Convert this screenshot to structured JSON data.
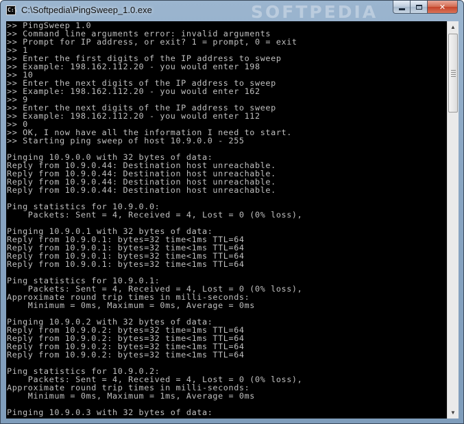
{
  "window": {
    "title": "C:\\Softpedia\\PingSweep_1.0.exe",
    "watermark": "SOFTPEDIA",
    "app_icon_glyph": "C:\\",
    "icons": {
      "app": "console-app-icon",
      "minimize": "minimize-icon",
      "maximize": "maximize-icon",
      "close": "close-icon"
    },
    "close_glyph": "✕"
  },
  "console": {
    "colors": {
      "background": "#000000",
      "text": "#c0c0c0"
    },
    "lines": [
      ">> PingSweep 1.0",
      ">> Command line arguments error: invalid arguments",
      ">> Prompt for IP address, or exit? 1 = prompt, 0 = exit",
      ">> 1",
      ">> Enter the first digits of the IP address to sweep",
      ">> Example: 198.162.112.20 - you would enter 198",
      ">> 10",
      ">> Enter the next digits of the IP address to sweep",
      ">> Example: 198.162.112.20 - you would enter 162",
      ">> 9",
      ">> Enter the next digits of the IP address to sweep",
      ">> Example: 198.162.112.20 - you would enter 112",
      ">> 0",
      ">> OK, I now have all the information I need to start.",
      ">> Starting ping sweep of host 10.9.0.0 - 255",
      "",
      "Pinging 10.9.0.0 with 32 bytes of data:",
      "Reply from 10.9.0.44: Destination host unreachable.",
      "Reply from 10.9.0.44: Destination host unreachable.",
      "Reply from 10.9.0.44: Destination host unreachable.",
      "Reply from 10.9.0.44: Destination host unreachable.",
      "",
      "Ping statistics for 10.9.0.0:",
      "    Packets: Sent = 4, Received = 4, Lost = 0 (0% loss),",
      "",
      "Pinging 10.9.0.1 with 32 bytes of data:",
      "Reply from 10.9.0.1: bytes=32 time<1ms TTL=64",
      "Reply from 10.9.0.1: bytes=32 time<1ms TTL=64",
      "Reply from 10.9.0.1: bytes=32 time<1ms TTL=64",
      "Reply from 10.9.0.1: bytes=32 time<1ms TTL=64",
      "",
      "Ping statistics for 10.9.0.1:",
      "    Packets: Sent = 4, Received = 4, Lost = 0 (0% loss),",
      "Approximate round trip times in milli-seconds:",
      "    Minimum = 0ms, Maximum = 0ms, Average = 0ms",
      "",
      "Pinging 10.9.0.2 with 32 bytes of data:",
      "Reply from 10.9.0.2: bytes=32 time=1ms TTL=64",
      "Reply from 10.9.0.2: bytes=32 time<1ms TTL=64",
      "Reply from 10.9.0.2: bytes=32 time<1ms TTL=64",
      "Reply from 10.9.0.2: bytes=32 time<1ms TTL=64",
      "",
      "Ping statistics for 10.9.0.2:",
      "    Packets: Sent = 4, Received = 4, Lost = 0 (0% loss),",
      "Approximate round trip times in milli-seconds:",
      "    Minimum = 0ms, Maximum = 1ms, Average = 0ms",
      "",
      "Pinging 10.9.0.3 with 32 bytes of data:"
    ]
  },
  "scrollbar": {
    "up_icon": "scroll-up-arrow-icon",
    "down_icon": "scroll-down-arrow-icon",
    "up_glyph": "▲",
    "down_glyph": "▼",
    "thumb_position_fraction": 0.0
  }
}
